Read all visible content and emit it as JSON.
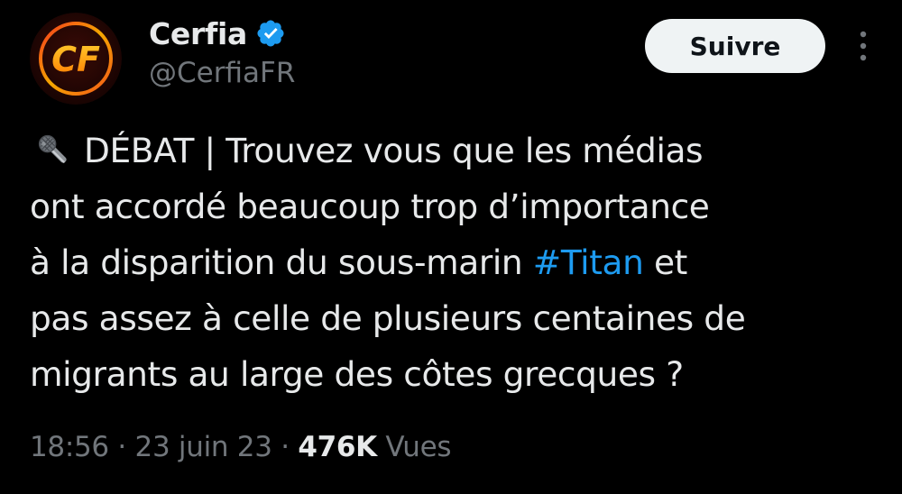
{
  "author": {
    "display_name": "Cerfia",
    "handle": "@CerfiaFR",
    "avatar_text": "CF",
    "verified_icon": "verified-badge-icon"
  },
  "actions": {
    "follow_label": "Suivre",
    "more_icon": "more-vertical-icon"
  },
  "tweet": {
    "emoji_icon": "microphone-icon",
    "lines": [
      "DÉBAT | Trouvez vous que les médias",
      "ont accordé beaucoup trop d’importance",
      "à la disparition du sous-marin ",
      "#Titan",
      " et",
      "pas assez à celle de plusieurs centaines de",
      "migrants au large des côtes grecques ?"
    ]
  },
  "meta": {
    "time": "18:56",
    "separator": " · ",
    "date": "23 juin 23",
    "views_count": "476K",
    "views_label": " Vues"
  },
  "colors": {
    "background": "#000000",
    "text": "#e7e9ea",
    "secondary": "#71767b",
    "link": "#1d9bf0",
    "verified": "#1d9bf0",
    "logo_orange": "#ff7a00"
  }
}
